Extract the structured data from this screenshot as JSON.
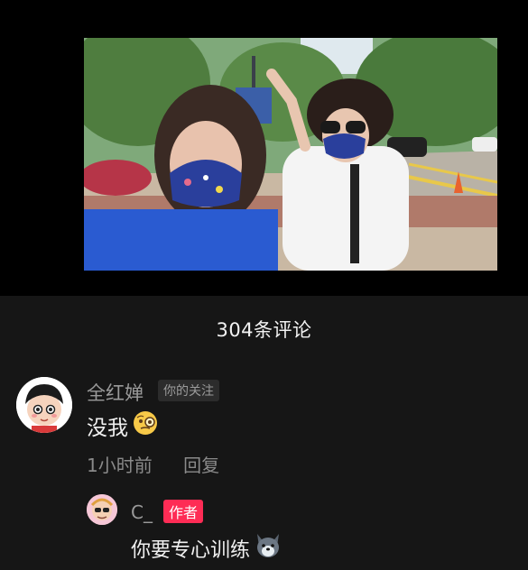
{
  "comments_panel": {
    "count_label": "304条评论"
  },
  "comments": [
    {
      "name": "全红婵",
      "tag": "你的关注",
      "text": "没我",
      "emoji": "monocle-face-emoji",
      "time": "1小时前",
      "reply_label": "回复"
    }
  ],
  "replies": [
    {
      "name": "C_",
      "tag": "作者",
      "text": "你要专心训练",
      "emoji": "wolf-face-emoji"
    }
  ],
  "colors": {
    "background": "#161616",
    "author_tag": "#fe2c55",
    "text_primary": "#f0f0f0",
    "text_secondary": "#9a9a9a"
  }
}
